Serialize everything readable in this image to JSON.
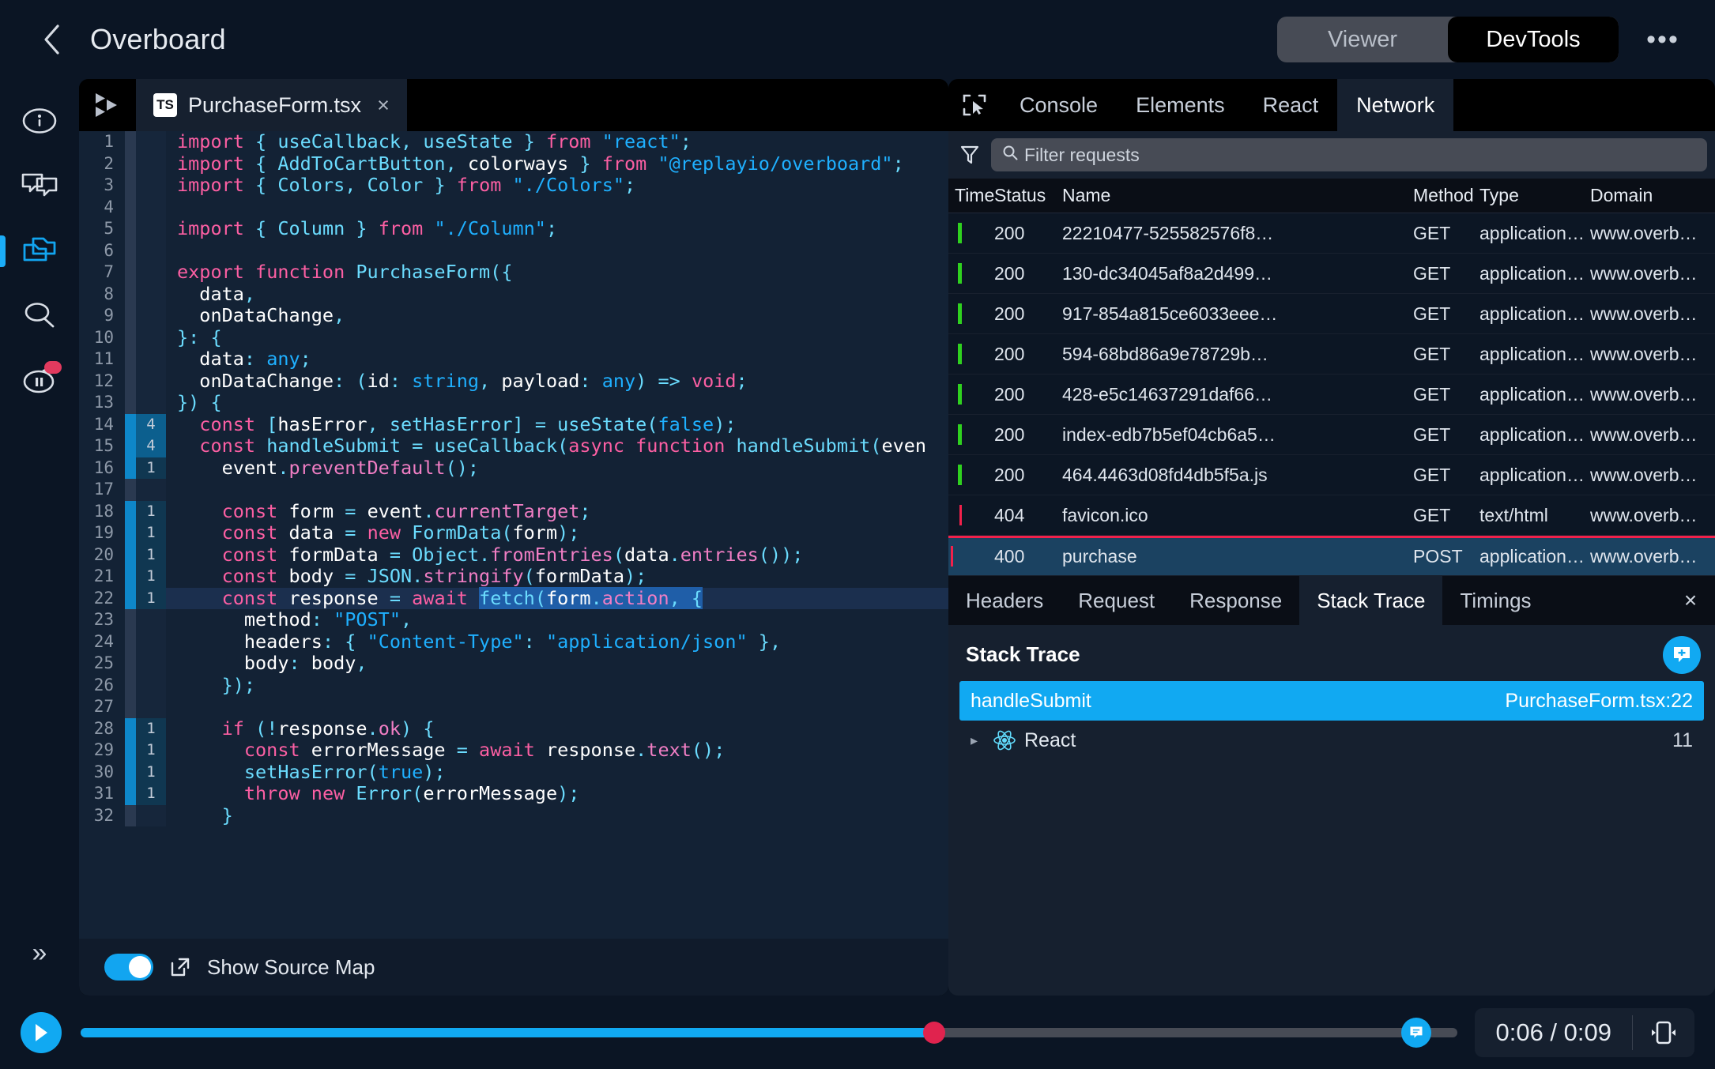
{
  "header": {
    "back_icon": "chevron-left-icon",
    "title": "Overboard",
    "viewer_label": "Viewer",
    "devtools_label": "DevTools",
    "kebab_label": "•••"
  },
  "rail": {
    "items": [
      {
        "name": "info-icon",
        "label": "Info"
      },
      {
        "name": "comments-icon",
        "label": "Comments"
      },
      {
        "name": "files-icon",
        "label": "Source Explorer",
        "active": true
      },
      {
        "name": "search-icon",
        "label": "Search"
      },
      {
        "name": "pause-replay-icon",
        "label": "Pause / Replay",
        "badge": true
      }
    ],
    "expand_label": "»"
  },
  "editor": {
    "logo_name": "replay-logo-icon",
    "tab": {
      "badge": "TS",
      "filename": "PurchaseForm.tsx",
      "close": "×"
    },
    "footer": {
      "toggle_on": true,
      "external_icon": "external-link-icon",
      "label": "Show Source Map"
    },
    "lines": [
      {
        "n": 1,
        "hits": "",
        "hot": false
      },
      {
        "n": 2,
        "hits": "",
        "hot": false
      },
      {
        "n": 3,
        "hits": "",
        "hot": false
      },
      {
        "n": 4,
        "hits": "",
        "hot": false
      },
      {
        "n": 5,
        "hits": "",
        "hot": false
      },
      {
        "n": 6,
        "hits": "",
        "hot": false
      },
      {
        "n": 7,
        "hits": "",
        "hot": false
      },
      {
        "n": 8,
        "hits": "",
        "hot": false
      },
      {
        "n": 9,
        "hits": "",
        "hot": false
      },
      {
        "n": 10,
        "hits": "",
        "hot": false
      },
      {
        "n": 11,
        "hits": "",
        "hot": false
      },
      {
        "n": 12,
        "hits": "",
        "hot": false
      },
      {
        "n": 13,
        "hits": "",
        "hot": false
      },
      {
        "n": 14,
        "hits": "4",
        "hot": true
      },
      {
        "n": 15,
        "hits": "4",
        "hot": true
      },
      {
        "n": 16,
        "hits": "1",
        "hot": true
      },
      {
        "n": 17,
        "hits": "",
        "hot": false
      },
      {
        "n": 18,
        "hits": "1",
        "hot": true
      },
      {
        "n": 19,
        "hits": "1",
        "hot": true
      },
      {
        "n": 20,
        "hits": "1",
        "hot": true
      },
      {
        "n": 21,
        "hits": "1",
        "hot": true
      },
      {
        "n": 22,
        "hits": "1",
        "hot": true
      },
      {
        "n": 23,
        "hits": "",
        "hot": false
      },
      {
        "n": 24,
        "hits": "",
        "hot": false
      },
      {
        "n": 25,
        "hits": "",
        "hot": false
      },
      {
        "n": 26,
        "hits": "",
        "hot": false
      },
      {
        "n": 27,
        "hits": "",
        "hot": false
      },
      {
        "n": 28,
        "hits": "1",
        "hot": true
      },
      {
        "n": 29,
        "hits": "1",
        "hot": true
      },
      {
        "n": 30,
        "hits": "1",
        "hot": true
      },
      {
        "n": 31,
        "hits": "1",
        "hot": true
      },
      {
        "n": 32,
        "hits": "",
        "hot": false
      }
    ],
    "source": [
      "import { useCallback, useState } from \"react\";",
      "import { AddToCartButton, colorways } from \"@replayio/overboard\";",
      "import { Colors, Color } from \"./Colors\";",
      "",
      "import { Column } from \"./Column\";",
      "",
      "export function PurchaseForm({",
      "  data,",
      "  onDataChange,",
      "}: {",
      "  data: any;",
      "  onDataChange: (id: string, payload: any) => void;",
      "}) {",
      "  const [hasError, setHasError] = useState(false);",
      "  const handleSubmit = useCallback(async function handleSubmit(even",
      "    event.preventDefault();",
      "",
      "    const form = event.currentTarget;",
      "    const data = new FormData(form);",
      "    const formData = Object.fromEntries(data.entries());",
      "    const body = JSON.stringify(formData);",
      "    const response = await fetch(form.action, {",
      "      method: \"POST\",",
      "      headers: { \"Content-Type\": \"application/json\" },",
      "      body: body,",
      "    });",
      "",
      "    if (!response.ok) {",
      "      const errorMessage = await response.text();",
      "      setHasError(true);",
      "      throw new Error(errorMessage);",
      "    }",
      "    }"
    ]
  },
  "devtools": {
    "picker_icon": "element-picker-icon",
    "tabs": [
      {
        "label": "Console",
        "active": false
      },
      {
        "label": "Elements",
        "active": false
      },
      {
        "label": "React",
        "active": false
      },
      {
        "label": "Network",
        "active": true
      }
    ],
    "filter": {
      "filter_icon": "funnel-icon",
      "search_icon": "search-icon",
      "placeholder": "Filter requests",
      "value": ""
    },
    "network": {
      "columns": [
        "Time",
        "Status",
        "Name",
        "Method",
        "Type",
        "Domain"
      ],
      "rows": [
        {
          "status": "200",
          "name": "22210477-525582576f8…",
          "method": "GET",
          "type": "application…",
          "domain": "www.overb…",
          "bar": "green",
          "selected": false
        },
        {
          "status": "200",
          "name": "130-dc34045af8a2d499…",
          "method": "GET",
          "type": "application…",
          "domain": "www.overb…",
          "bar": "green",
          "selected": false
        },
        {
          "status": "200",
          "name": "917-854a815ce6033eee…",
          "method": "GET",
          "type": "application…",
          "domain": "www.overb…",
          "bar": "green",
          "selected": false
        },
        {
          "status": "200",
          "name": "594-68bd86a9e78729b…",
          "method": "GET",
          "type": "application…",
          "domain": "www.overb…",
          "bar": "green",
          "selected": false
        },
        {
          "status": "200",
          "name": "428-e5c14637291daf66…",
          "method": "GET",
          "type": "application…",
          "domain": "www.overb…",
          "bar": "green",
          "selected": false
        },
        {
          "status": "200",
          "name": "index-edb7b5ef04cb6a5…",
          "method": "GET",
          "type": "application…",
          "domain": "www.overb…",
          "bar": "green",
          "selected": false
        },
        {
          "status": "200",
          "name": "464.4463d08fd4db5f5a.js",
          "method": "GET",
          "type": "application…",
          "domain": "www.overb…",
          "bar": "green",
          "selected": false
        },
        {
          "status": "404",
          "name": "favicon.ico",
          "method": "GET",
          "type": "text/html",
          "domain": "www.overb…",
          "bar": "pink",
          "selected": false
        },
        {
          "status": "400",
          "name": "purchase",
          "method": "POST",
          "type": "application…",
          "domain": "www.overb…",
          "bar": "blue",
          "selected": true
        }
      ]
    },
    "detail": {
      "tabs": [
        {
          "label": "Headers",
          "active": false
        },
        {
          "label": "Request",
          "active": false
        },
        {
          "label": "Response",
          "active": false
        },
        {
          "label": "Stack Trace",
          "active": true
        },
        {
          "label": "Timings",
          "active": false
        }
      ],
      "close": "×",
      "title": "Stack Trace",
      "comment_icon": "add-comment-icon",
      "frames": [
        {
          "name": "handleSubmit",
          "location": "PurchaseForm.tsx:22",
          "selected": true,
          "group": false
        },
        {
          "name": "React",
          "location": "11",
          "selected": false,
          "group": true,
          "icon": "react-icon",
          "caret": "▸"
        }
      ]
    }
  },
  "playbar": {
    "play_icon": "play-icon",
    "progress_percent": 62,
    "handle_percent": 62,
    "comment_marker_percent": 97,
    "comment_icon": "comment-marker-icon",
    "current_time": "0:06",
    "total_time": "0:09",
    "time_display": "0:06 / 0:09",
    "view_icon": "toggle-viewport-icon"
  },
  "colors": {
    "accent_blue": "#11a9f2",
    "handle_red": "#e0234e",
    "error_pink": "#f2214b",
    "success_green": "#2fd11f",
    "panel_bg": "#16202f",
    "page_bg": "#0b1524"
  }
}
